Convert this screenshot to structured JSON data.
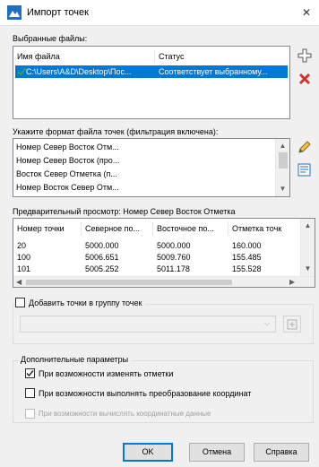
{
  "window": {
    "title": "Импорт точек",
    "close_glyph": "✕"
  },
  "selected_files": {
    "label": "Выбранные файлы:",
    "columns": [
      "Имя файла",
      "Статус"
    ],
    "rows": [
      {
        "name": "C:\\Users\\A&D\\Desktop\\Пос...",
        "status": "Соответствует выбранному..."
      }
    ]
  },
  "format": {
    "label": "Укажите формат файла точек (фильтрация включена):",
    "items": [
      "Номер Север Восток Отм...",
      "Номер Север Восток (про...",
      "Восток Север Отметка (п...",
      "Номер Восток Север Отм..."
    ]
  },
  "preview": {
    "label": "Предварительный просмотр: Номер Север Восток Отметка",
    "columns": [
      "Номер точки",
      "Северное по...",
      "Восточное по...",
      "Отметка точк"
    ],
    "rows": [
      [
        "20",
        "5000.000",
        "5000.000",
        "160.000"
      ],
      [
        "100",
        "5006.651",
        "5009.760",
        "155.485"
      ],
      [
        "101",
        "5005.252",
        "5011.178",
        "155.528"
      ]
    ]
  },
  "group": {
    "checkbox_label": "Добавить точки в группу точек",
    "checked": false
  },
  "advanced": {
    "label": "Дополнительные параметры",
    "options": [
      {
        "label": "При возможности изменять отметки",
        "checked": true,
        "enabled": true
      },
      {
        "label": "При возможности выполнять преобразование координат",
        "checked": false,
        "enabled": true
      },
      {
        "label": "При возможности вычислять координатные данные",
        "checked": false,
        "enabled": false
      }
    ]
  },
  "buttons": {
    "ok": "OK",
    "cancel": "Отмена",
    "help": "Справка"
  },
  "colors": {
    "accent": "#0078d7",
    "selection": "#0078d7",
    "check_green": "#3aa04a",
    "delete_red": "#d32f2f"
  }
}
